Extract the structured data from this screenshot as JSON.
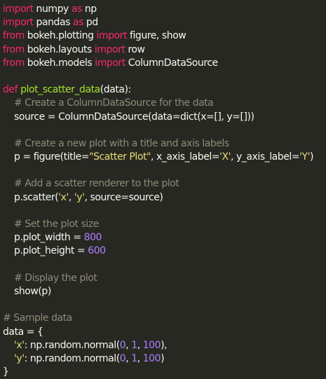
{
  "code": {
    "lines": [
      [
        [
          "kw",
          "import"
        ],
        [
          "bi",
          " numpy "
        ],
        [
          "kw",
          "as"
        ],
        [
          "bi",
          " np"
        ]
      ],
      [
        [
          "kw",
          "import"
        ],
        [
          "bi",
          " pandas "
        ],
        [
          "kw",
          "as"
        ],
        [
          "bi",
          " pd"
        ]
      ],
      [
        [
          "kw",
          "from"
        ],
        [
          "bi",
          " bokeh.plotting "
        ],
        [
          "kw",
          "import"
        ],
        [
          "bi",
          " figure, show"
        ]
      ],
      [
        [
          "kw",
          "from"
        ],
        [
          "bi",
          " bokeh.layouts "
        ],
        [
          "kw",
          "import"
        ],
        [
          "bi",
          " row"
        ]
      ],
      [
        [
          "kw",
          "from"
        ],
        [
          "bi",
          " bokeh.models "
        ],
        [
          "kw",
          "import"
        ],
        [
          "bi",
          " ColumnDataSource"
        ]
      ],
      [],
      [
        [
          "kw",
          "def"
        ],
        [
          "bi",
          " "
        ],
        [
          "fn",
          "plot_scatter_data"
        ],
        [
          "bi",
          "(data):"
        ]
      ],
      [
        [
          "bi",
          "    "
        ],
        [
          "cm",
          "# Create a ColumnDataSource for the data"
        ]
      ],
      [
        [
          "bi",
          "    source = ColumnDataSource(data=dict(x=[], y=[]))"
        ]
      ],
      [],
      [
        [
          "bi",
          "    "
        ],
        [
          "cm",
          "# Create a new plot with a title and axis labels"
        ]
      ],
      [
        [
          "bi",
          "    p = figure(title="
        ],
        [
          "str",
          "\"Scatter Plot\""
        ],
        [
          "bi",
          ", x_axis_label="
        ],
        [
          "str",
          "'X'"
        ],
        [
          "bi",
          ", y_axis_label="
        ],
        [
          "str",
          "'Y'"
        ],
        [
          "bi",
          ")"
        ]
      ],
      [],
      [
        [
          "bi",
          "    "
        ],
        [
          "cm",
          "# Add a scatter renderer to the plot"
        ]
      ],
      [
        [
          "bi",
          "    p.scatter("
        ],
        [
          "str",
          "'x'"
        ],
        [
          "bi",
          ", "
        ],
        [
          "str",
          "'y'"
        ],
        [
          "bi",
          ", source=source)"
        ]
      ],
      [],
      [
        [
          "bi",
          "    "
        ],
        [
          "cm",
          "# Set the plot size"
        ]
      ],
      [
        [
          "bi",
          "    p.plot_width = "
        ],
        [
          "num",
          "800"
        ]
      ],
      [
        [
          "bi",
          "    p.plot_height = "
        ],
        [
          "num",
          "600"
        ]
      ],
      [],
      [
        [
          "bi",
          "    "
        ],
        [
          "cm",
          "# Display the plot"
        ]
      ],
      [
        [
          "bi",
          "    show(p)"
        ]
      ],
      [],
      [
        [
          "cm",
          "# Sample data"
        ]
      ],
      [
        [
          "bi",
          "data = {"
        ]
      ],
      [
        [
          "bi",
          "    "
        ],
        [
          "str",
          "'x'"
        ],
        [
          "bi",
          ": np.random.normal("
        ],
        [
          "num",
          "0"
        ],
        [
          "bi",
          ", "
        ],
        [
          "num",
          "1"
        ],
        [
          "bi",
          ", "
        ],
        [
          "num",
          "100"
        ],
        [
          "bi",
          "),"
        ]
      ],
      [
        [
          "bi",
          "    "
        ],
        [
          "str",
          "'y'"
        ],
        [
          "bi",
          ": np.random.normal("
        ],
        [
          "num",
          "0"
        ],
        [
          "bi",
          ", "
        ],
        [
          "num",
          "1"
        ],
        [
          "bi",
          ", "
        ],
        [
          "num",
          "100"
        ],
        [
          "bi",
          ")"
        ]
      ],
      [
        [
          "bi",
          "}"
        ]
      ]
    ]
  }
}
